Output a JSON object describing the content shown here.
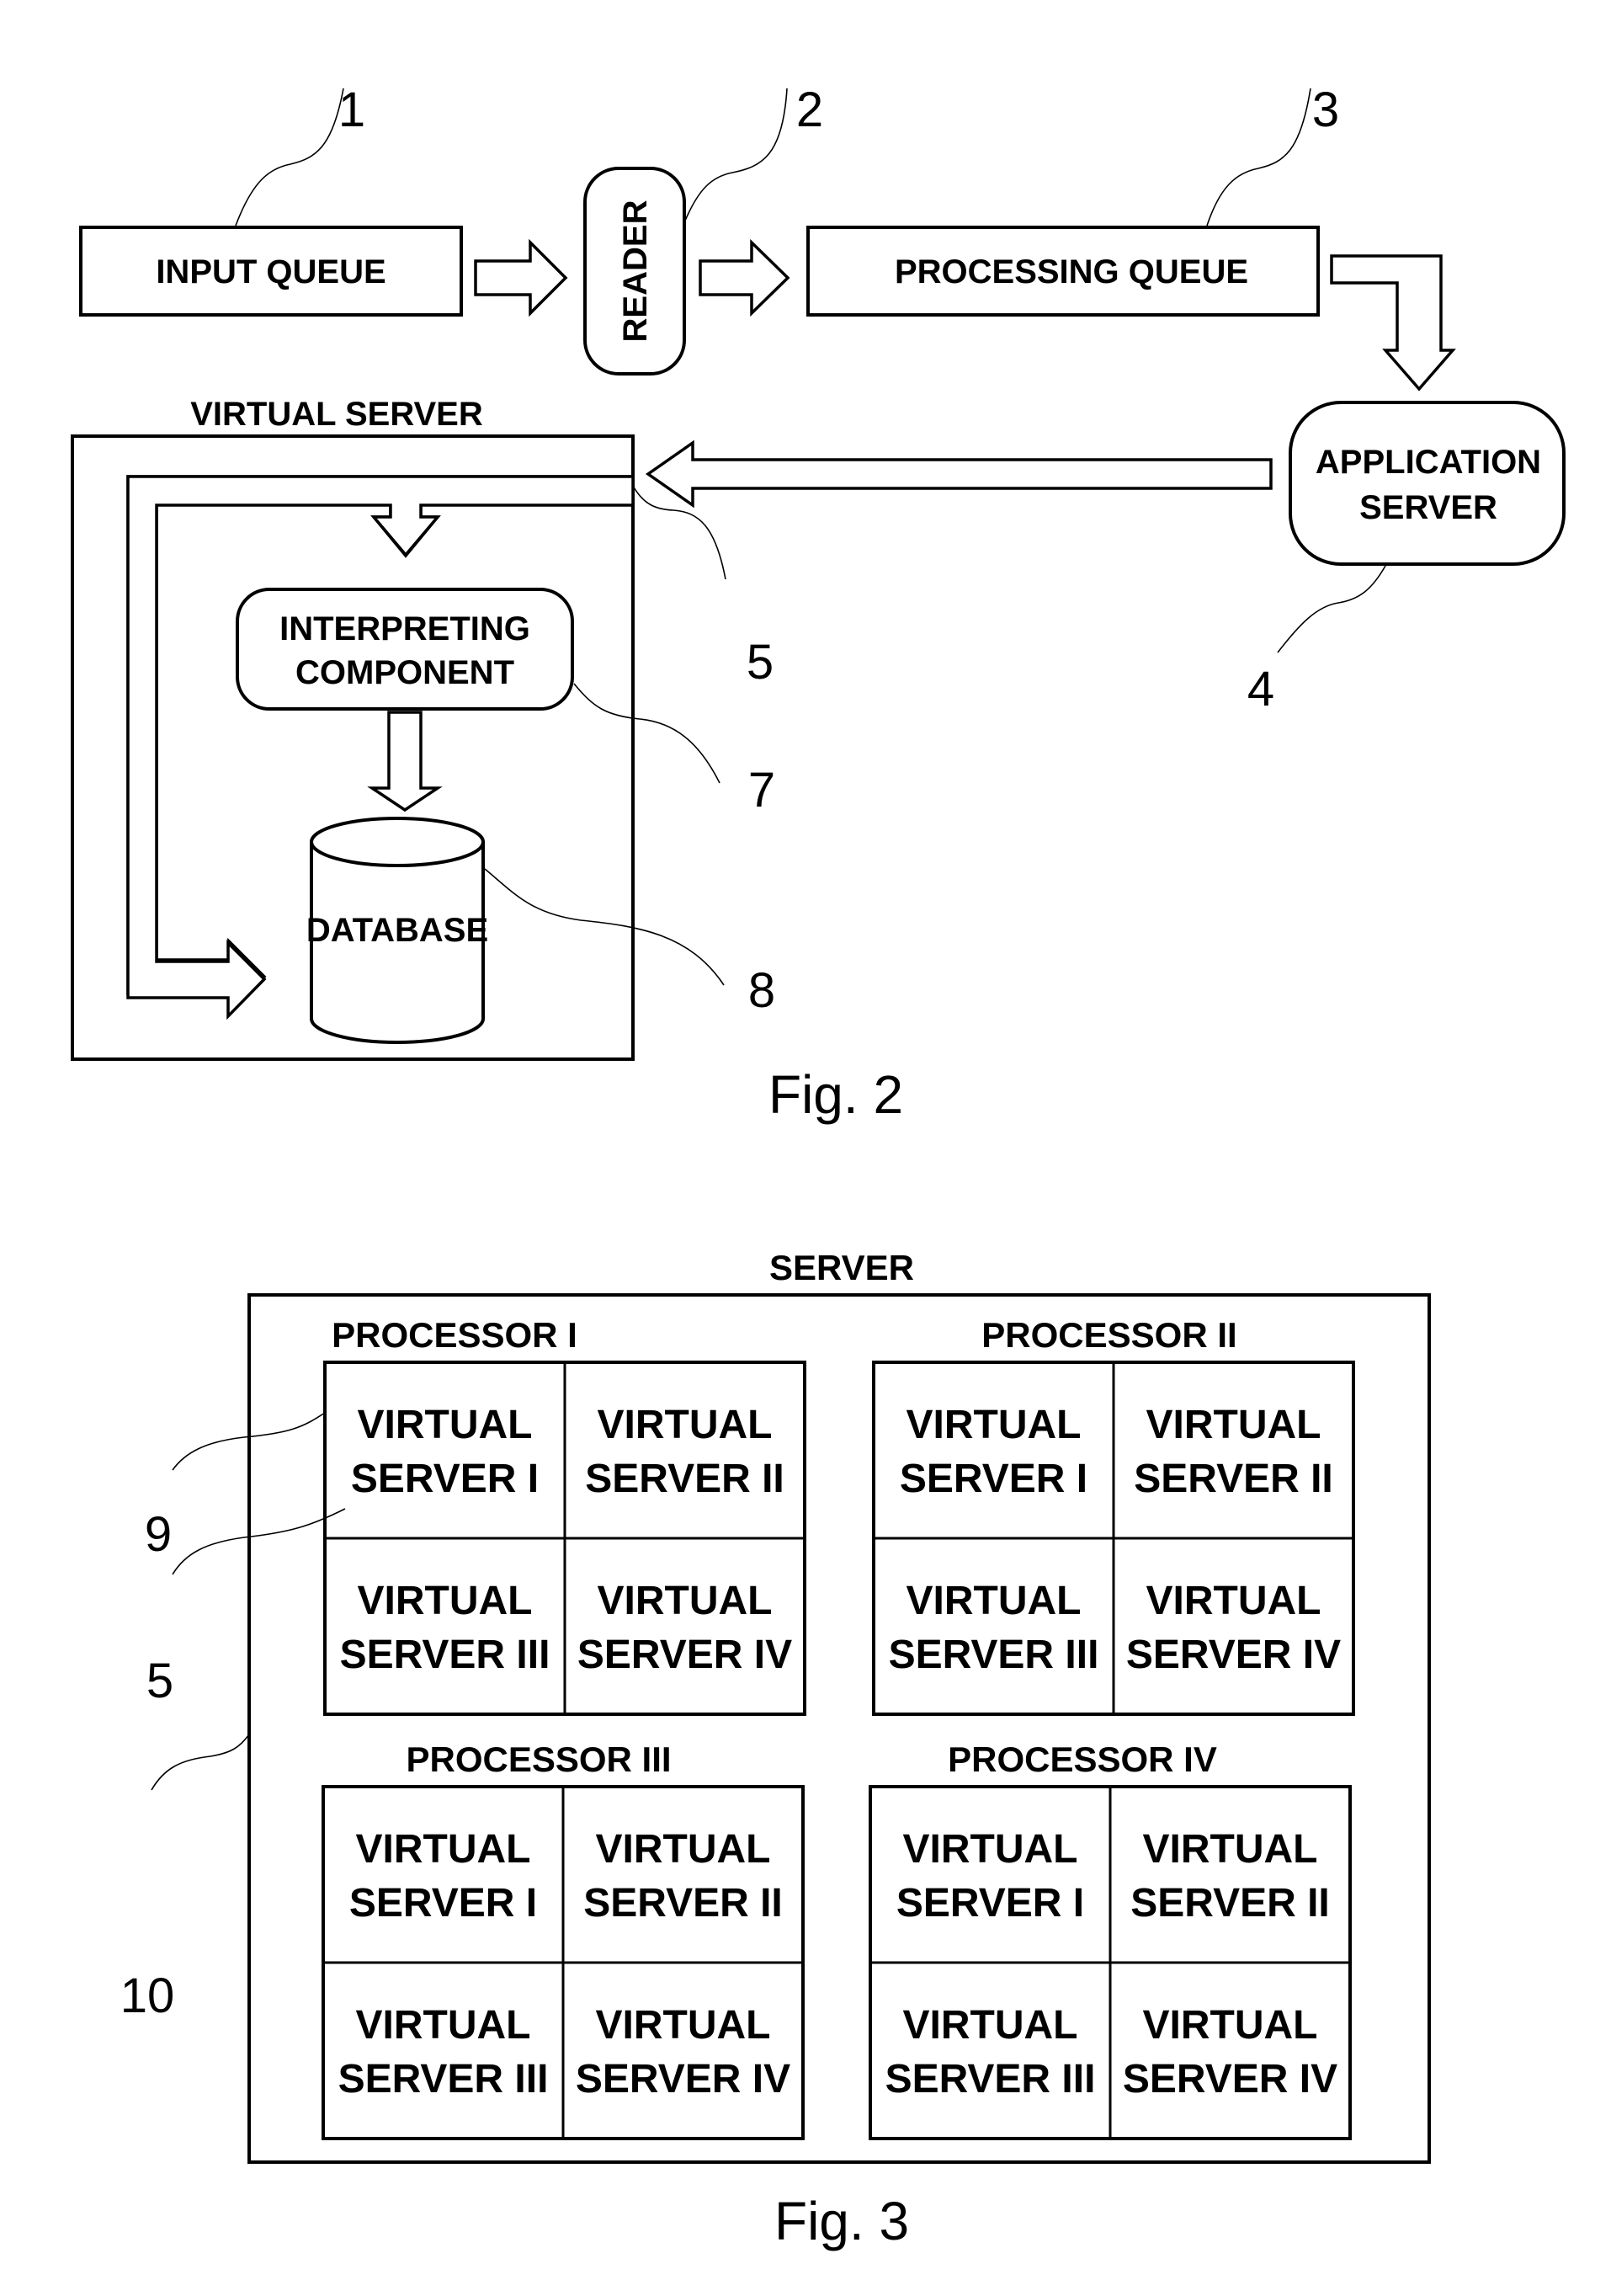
{
  "figure2": {
    "caption": "Fig. 2",
    "input_queue": {
      "label": "INPUT QUEUE",
      "ref": "1"
    },
    "reader": {
      "label": "READER",
      "ref": "2"
    },
    "processing_queue": {
      "label": "PROCESSING QUEUE",
      "ref": "3"
    },
    "application_server": {
      "label_line1": "APPLICATION",
      "label_line2": "SERVER",
      "ref": "4"
    },
    "virtual_server": {
      "label": "VIRTUAL SERVER",
      "ref": "5"
    },
    "interpreting_component": {
      "label_line1": "INTERPRETING",
      "label_line2": "COMPONENT",
      "ref": "7"
    },
    "database": {
      "label": "DATABASE",
      "ref": "8"
    }
  },
  "figure3": {
    "caption": "Fig. 3",
    "server": {
      "label": "SERVER",
      "ref": "10"
    },
    "refs": {
      "virtual_server_i": "9",
      "virtual_server_iii": "5"
    },
    "processors": [
      {
        "label": "PROCESSOR I",
        "virtual_servers": [
          {
            "line1": "VIRTUAL",
            "line2": "SERVER I"
          },
          {
            "line1": "VIRTUAL",
            "line2": "SERVER II"
          },
          {
            "line1": "VIRTUAL",
            "line2": "SERVER III"
          },
          {
            "line1": "VIRTUAL",
            "line2": "SERVER IV"
          }
        ]
      },
      {
        "label": "PROCESSOR II",
        "virtual_servers": [
          {
            "line1": "VIRTUAL",
            "line2": "SERVER I"
          },
          {
            "line1": "VIRTUAL",
            "line2": "SERVER II"
          },
          {
            "line1": "VIRTUAL",
            "line2": "SERVER III"
          },
          {
            "line1": "VIRTUAL",
            "line2": "SERVER IV"
          }
        ]
      },
      {
        "label": "PROCESSOR III",
        "virtual_servers": [
          {
            "line1": "VIRTUAL",
            "line2": "SERVER I"
          },
          {
            "line1": "VIRTUAL",
            "line2": "SERVER II"
          },
          {
            "line1": "VIRTUAL",
            "line2": "SERVER III"
          },
          {
            "line1": "VIRTUAL",
            "line2": "SERVER IV"
          }
        ]
      },
      {
        "label": "PROCESSOR IV",
        "virtual_servers": [
          {
            "line1": "VIRTUAL",
            "line2": "SERVER I"
          },
          {
            "line1": "VIRTUAL",
            "line2": "SERVER II"
          },
          {
            "line1": "VIRTUAL",
            "line2": "SERVER III"
          },
          {
            "line1": "VIRTUAL",
            "line2": "SERVER IV"
          }
        ]
      }
    ]
  }
}
